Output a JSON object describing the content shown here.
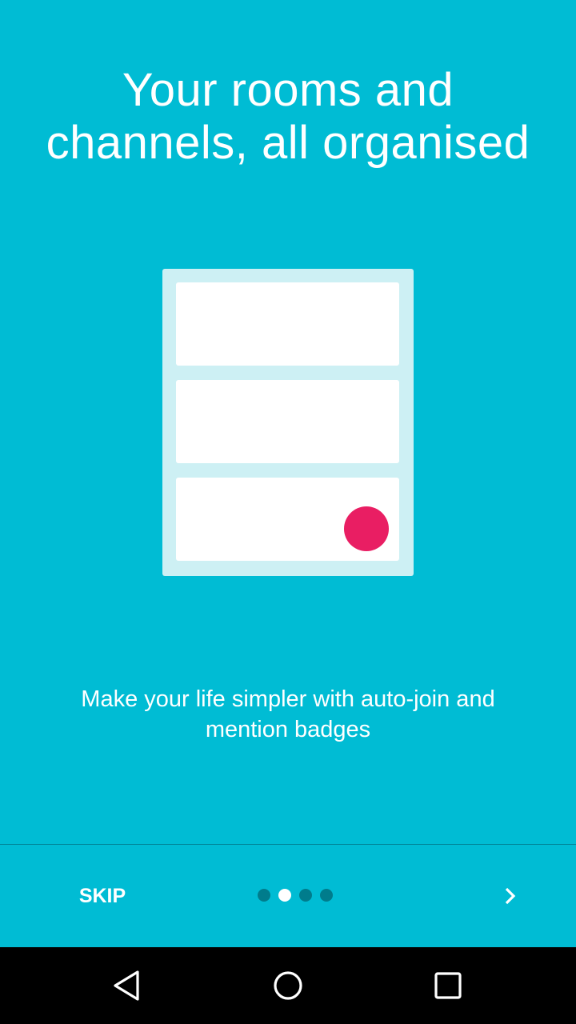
{
  "onboarding": {
    "title": "Your rooms and channels, all organised",
    "description": "Make your life simpler with auto-join and mention badges",
    "skip_label": "SKIP",
    "page_count": 4,
    "current_page": 2
  },
  "colors": {
    "background": "#00BCD4",
    "illustration_frame": "#CDF0F4",
    "card": "#FFFFFF",
    "mention_badge": "#E91E63",
    "pager_inactive": "#007C8C",
    "pager_active": "#FFFFFF",
    "navbar": "#000000"
  },
  "icons": {
    "next": "chevron-right-icon",
    "nav_back": "triangle-back-icon",
    "nav_home": "circle-home-icon",
    "nav_recents": "square-recents-icon"
  }
}
